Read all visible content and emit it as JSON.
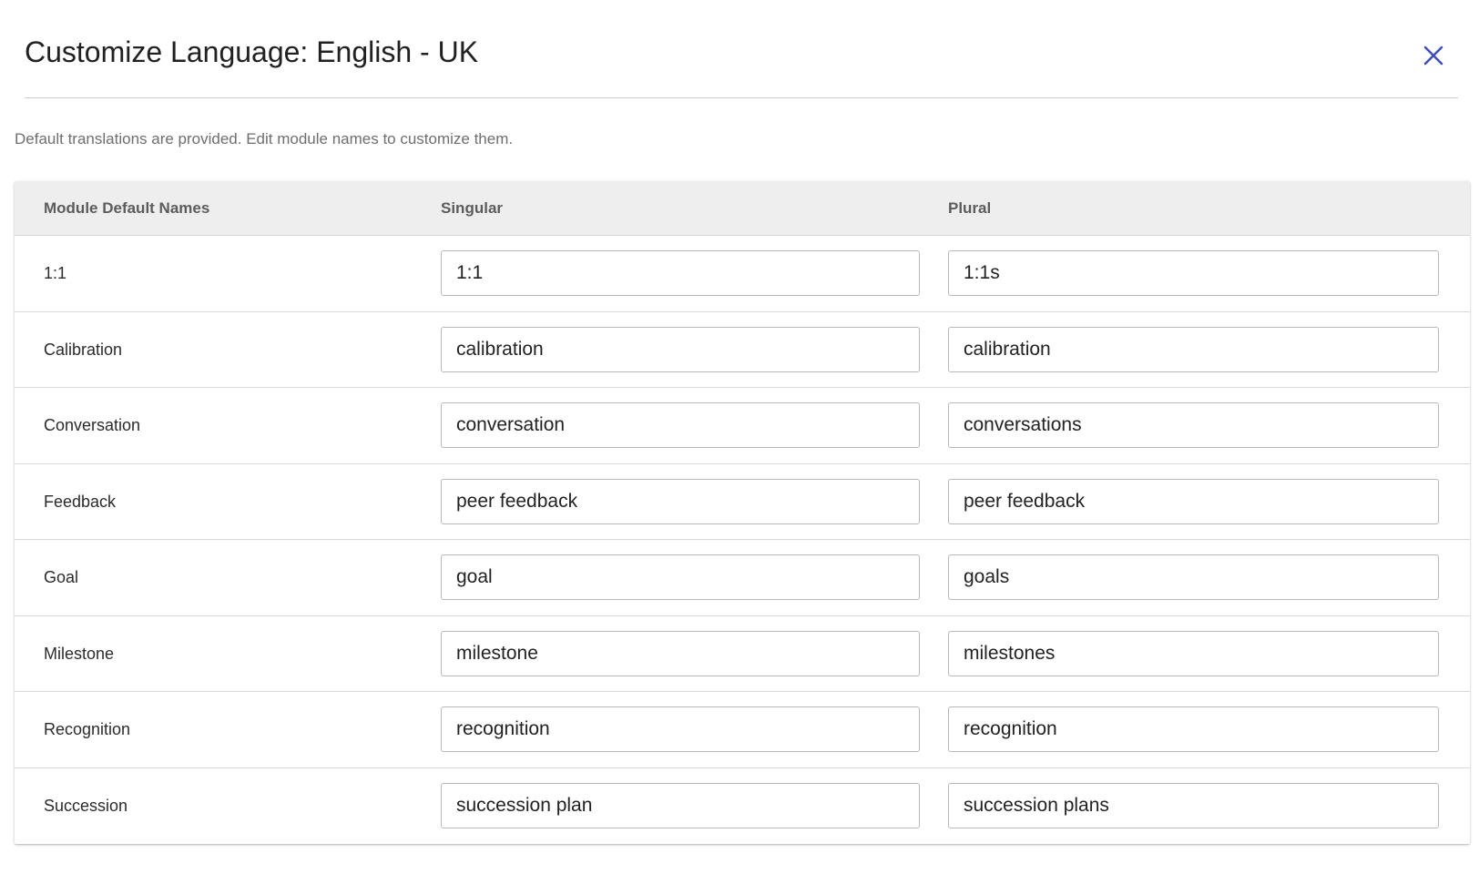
{
  "dialog": {
    "title": "Customize Language: English - UK",
    "description": "Default translations are provided. Edit module names to customize them.",
    "close_icon": "close-icon",
    "accent_color": "#3f51b5"
  },
  "table": {
    "headers": {
      "name": "Module Default Names",
      "singular": "Singular",
      "plural": "Plural"
    },
    "rows": [
      {
        "name": "1:1",
        "singular": "1:1",
        "plural": "1:1s"
      },
      {
        "name": "Calibration",
        "singular": "calibration",
        "plural": "calibration"
      },
      {
        "name": "Conversation",
        "singular": "conversation",
        "plural": "conversations"
      },
      {
        "name": "Feedback",
        "singular": "peer feedback",
        "plural": "peer feedback"
      },
      {
        "name": "Goal",
        "singular": "goal",
        "plural": "goals"
      },
      {
        "name": "Milestone",
        "singular": "milestone",
        "plural": "milestones"
      },
      {
        "name": "Recognition",
        "singular": "recognition",
        "plural": "recognition"
      },
      {
        "name": "Succession",
        "singular": "succession plan",
        "plural": "succession plans"
      }
    ]
  }
}
